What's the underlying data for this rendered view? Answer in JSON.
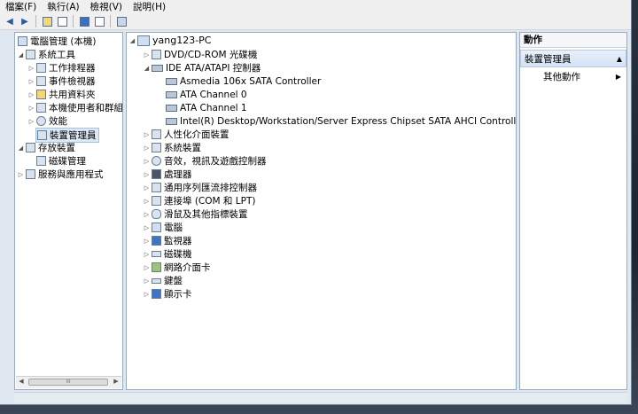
{
  "menubar": {
    "items": [
      "檔案(F)",
      "執行(A)",
      "檢視(V)",
      "說明(H)"
    ]
  },
  "left_tree": {
    "root": "電腦管理 (本機)",
    "system_tools": "系統工具",
    "task_scheduler": "工作排程器",
    "event_viewer": "事件檢視器",
    "shared_folders": "共用資料夾",
    "local_users": "本機使用者和群組",
    "performance": "效能",
    "device_manager": "裝置管理員",
    "storage": "存放裝置",
    "disk_management": "磁碟管理",
    "services_apps": "服務與應用程式"
  },
  "device_tree": {
    "computer": "yang123-PC",
    "dvd": "DVD/CD-ROM 光碟機",
    "ide": "IDE ATA/ATAPI 控制器",
    "ide_children": [
      "Asmedia 106x SATA Controller",
      "ATA Channel 0",
      "ATA Channel 1",
      "Intel(R) Desktop/Workstation/Server Express Chipset SATA AHCI Controller"
    ],
    "categories": [
      "人性化介面裝置",
      "系統裝置",
      "音效，視訊及遊戲控制器",
      "處理器",
      "通用序列匯流排控制器",
      "連接埠 (COM 和 LPT)",
      "滑鼠及其他指標裝置",
      "電腦",
      "監視器",
      "磁碟機",
      "網路介面卡",
      "鍵盤",
      "顯示卡"
    ]
  },
  "actions": {
    "header": "動作",
    "section": "裝置管理員",
    "more_actions": "其他動作"
  },
  "scrollbar": {
    "grip": "III"
  }
}
